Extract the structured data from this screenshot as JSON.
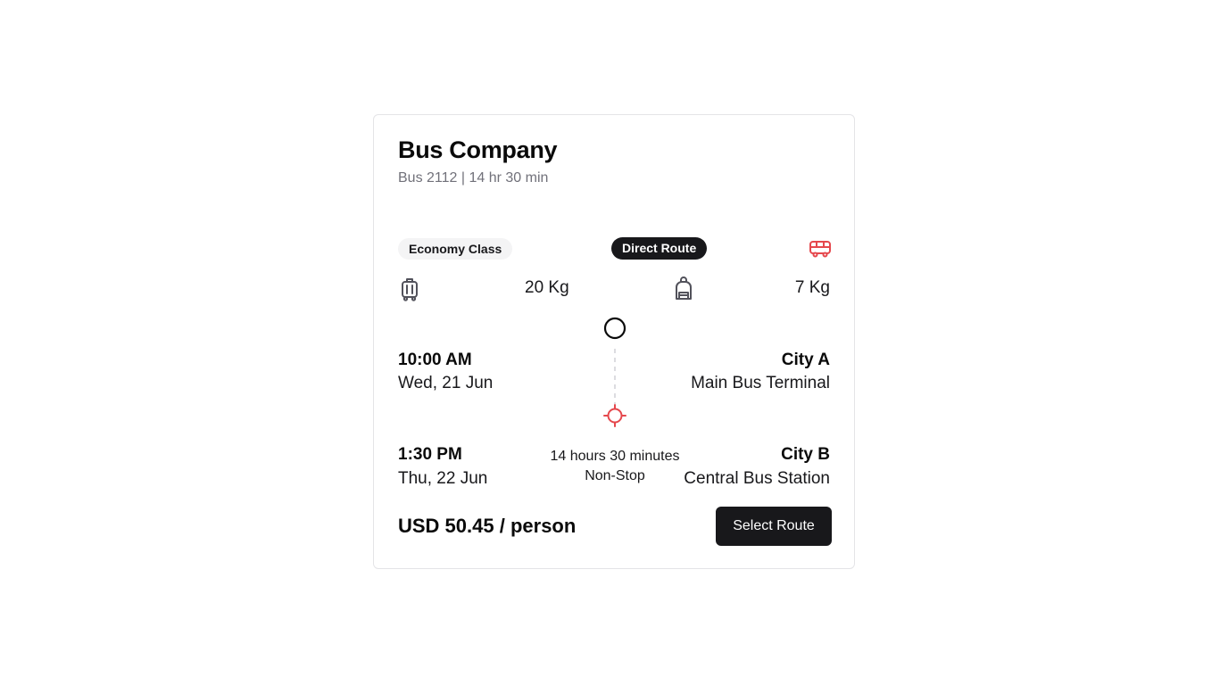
{
  "header": {
    "company": "Bus Company",
    "subtitle": "Bus 2112 | 14 hr 30 min"
  },
  "badges": {
    "class": "Economy Class",
    "route": "Direct Route"
  },
  "baggage": {
    "checked_weight": "20 Kg",
    "cabin_weight": "7 Kg"
  },
  "departure": {
    "time": "10:00 AM",
    "date": "Wed, 21 Jun",
    "city": "City A",
    "station": "Main Bus Terminal"
  },
  "arrival": {
    "time": "1:30 PM",
    "date": "Thu, 22 Jun",
    "city": "City B",
    "station": "Central Bus Station"
  },
  "trip": {
    "duration": "14 hours 30 minutes",
    "stops": "Non-Stop"
  },
  "footer": {
    "price": "USD 50.45 / person",
    "select_label": "Select Route"
  },
  "icons": {
    "bus": "bus-icon",
    "luggage": "luggage-icon",
    "backpack": "backpack-icon",
    "origin": "origin-circle-icon",
    "destination": "crosshair-icon"
  },
  "colors": {
    "accent": "#e5484d",
    "dark": "#18181b",
    "muted": "#71717a",
    "badge_bg": "#f4f4f5"
  }
}
